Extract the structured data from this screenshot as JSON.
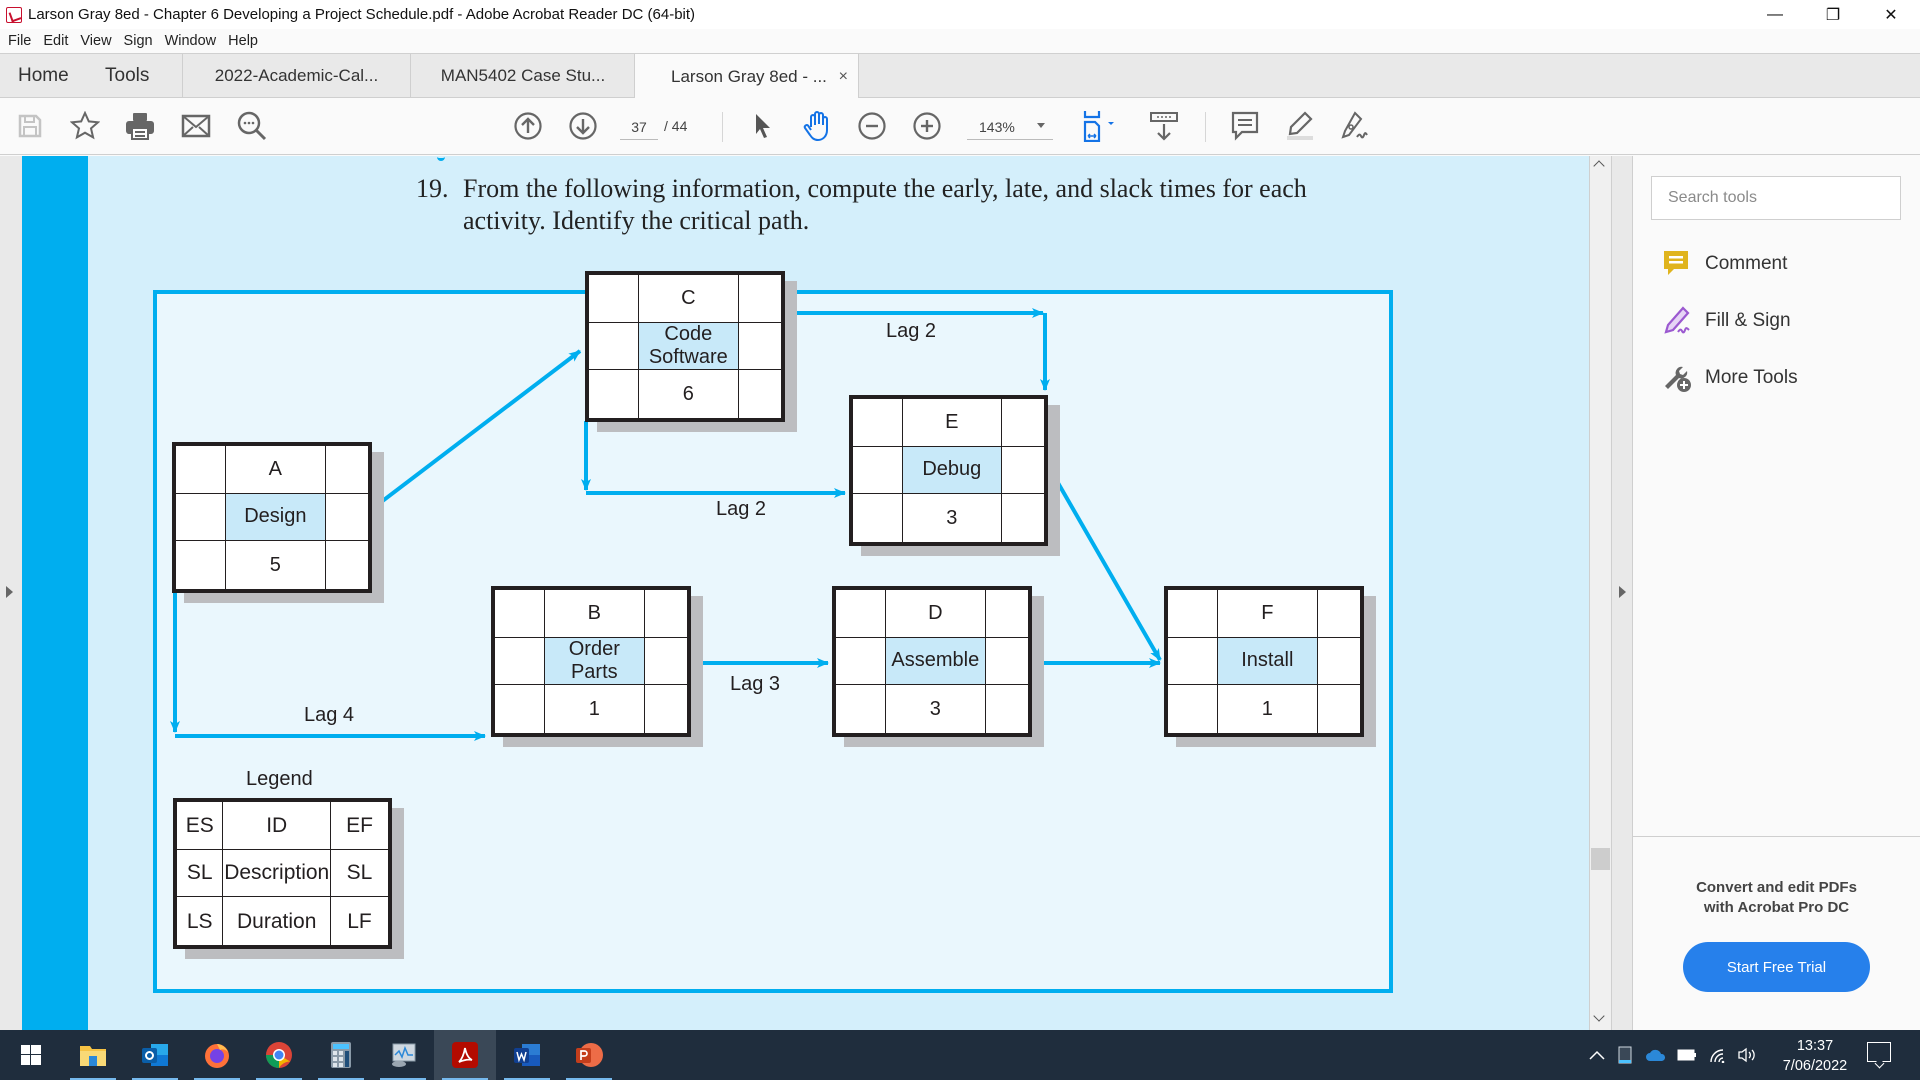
{
  "window": {
    "title": "Larson Gray 8ed - Chapter 6  Developing a Project Schedule.pdf - Adobe Acrobat Reader DC (64-bit)",
    "controls": {
      "minimize": "—",
      "maximize": "❐",
      "close": "✕"
    }
  },
  "menu": [
    "File",
    "Edit",
    "View",
    "Sign",
    "Window",
    "Help"
  ],
  "tabs": {
    "home": "Home",
    "tools": "Tools",
    "documents": [
      {
        "label": "2022-Academic-Cal...",
        "active": false
      },
      {
        "label": "MAN5402 Case Stu...",
        "active": false
      },
      {
        "label": "Larson Gray 8ed - ...",
        "active": true
      }
    ],
    "close_glyph": "×"
  },
  "toolbar": {
    "icons": [
      "save-icon",
      "bookmark-star-icon",
      "print-icon",
      "email-icon",
      "search-icon",
      "page-up-icon",
      "page-down-icon",
      "select-cursor-icon",
      "hand-tool-icon",
      "zoom-out-icon",
      "zoom-in-icon",
      "fit-page-icon",
      "scroll-mode-icon",
      "comment-icon",
      "highlight-icon",
      "sign-icon"
    ],
    "current_page": "37",
    "total_pages": "/ 44",
    "zoom_level": "143%"
  },
  "document": {
    "question_number": "19.",
    "question_line1": "From the following information, compute the early, late, and slack times for each",
    "question_line2": "activity. Identify the critical path.",
    "nodes": [
      {
        "id": "A",
        "description": "Design",
        "duration": "5"
      },
      {
        "id": "B",
        "description": "Order Parts",
        "duration": "1"
      },
      {
        "id": "C",
        "description": "Code Software",
        "duration": "6"
      },
      {
        "id": "D",
        "description": "Assemble",
        "duration": "3"
      },
      {
        "id": "E",
        "description": "Debug",
        "duration": "3"
      },
      {
        "id": "F",
        "description": "Install",
        "duration": "1"
      }
    ],
    "links": [
      {
        "from": "A",
        "to": "C",
        "lag": ""
      },
      {
        "from": "A",
        "to": "B",
        "lag": "Lag 4"
      },
      {
        "from": "C",
        "to": "E",
        "lag": "Lag 2",
        "type": "finish-to-finish"
      },
      {
        "from": "C",
        "to": "E",
        "lag": "Lag 2",
        "type": "start-to-start"
      },
      {
        "from": "B",
        "to": "D",
        "lag": "Lag 3"
      },
      {
        "from": "D",
        "to": "F",
        "lag": ""
      },
      {
        "from": "E",
        "to": "F",
        "lag": ""
      }
    ],
    "lag_labels": {
      "a_b": "Lag 4",
      "c_e_top": "Lag 2",
      "c_e_bottom": "Lag 2",
      "b_d": "Lag 3"
    },
    "legend": {
      "title": "Legend",
      "rows": [
        [
          "ES",
          "ID",
          "EF"
        ],
        [
          "SL",
          "Description",
          "SL"
        ],
        [
          "LS",
          "Duration",
          "LF"
        ]
      ]
    },
    "colors": {
      "accent": "#00aeef",
      "page_bg": "#d4effb",
      "frame_bg": "#eaf7fd",
      "desc_cell": "#c8e9f9"
    }
  },
  "right_panel": {
    "search_placeholder": "Search tools",
    "tools": [
      {
        "label": "Comment",
        "icon": "comment-icon",
        "color": "#e0b41d"
      },
      {
        "label": "Fill & Sign",
        "icon": "fill-sign-icon",
        "color": "#9b59d0"
      },
      {
        "label": "More Tools",
        "icon": "more-tools-icon",
        "color": "#666666"
      }
    ],
    "promo_line1": "Convert and edit PDFs",
    "promo_line2": "with Acrobat Pro DC",
    "trial_button": "Start Free Trial"
  },
  "taskbar": {
    "apps": [
      "windows-start",
      "file-explorer",
      "outlook",
      "firefox",
      "chrome",
      "calculator",
      "performance-monitor",
      "acrobat-reader",
      "word",
      "powerpoint"
    ],
    "time": "13:37",
    "date": "7/06/2022"
  }
}
